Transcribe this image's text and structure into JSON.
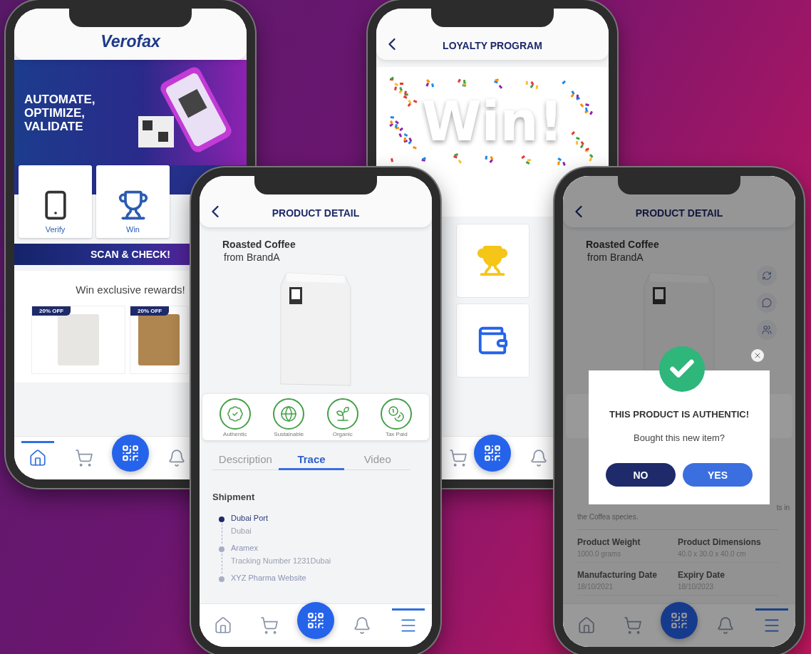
{
  "home_screen": {
    "logo": "Verofax",
    "banner": "AUTOMATE,\nOPTIMIZE,\nVALIDATE",
    "tiles": [
      {
        "label": "Verify"
      },
      {
        "label": "Win"
      }
    ],
    "scan_bar": "SCAN & CHECK!",
    "rewards_title": "Win exclusive rewards!",
    "offers": [
      {
        "badge": "20% OFF"
      },
      {
        "badge": "20% OFF"
      }
    ],
    "nav": [
      {
        "kind": "home",
        "selected": true
      },
      {
        "kind": "cart",
        "selected": false
      },
      {
        "kind": "scan",
        "selected": false
      },
      {
        "kind": "bell",
        "selected": false
      }
    ]
  },
  "loyalty_screen": {
    "title": "LOYALTY PROGRAM",
    "art_text": "Win!",
    "nav": [
      {
        "kind": "cart",
        "selected": false
      },
      {
        "kind": "scan",
        "selected": false
      },
      {
        "kind": "bell",
        "selected": false
      }
    ]
  },
  "product_screen": {
    "title": "PRODUCT DETAIL",
    "product": "Roasted Coffee",
    "brand": "from BrandA",
    "badges": [
      {
        "kind": "stamp",
        "label": "Authentic"
      },
      {
        "kind": "globe",
        "label": "Sustainable"
      },
      {
        "kind": "sprout",
        "label": "Organic"
      },
      {
        "kind": "coins",
        "label": "Tax Paid"
      }
    ],
    "tabs": [
      {
        "label": "Description",
        "selected": false
      },
      {
        "label": "Trace",
        "selected": true
      },
      {
        "label": "Video",
        "selected": false
      }
    ],
    "section": "Shipment",
    "timeline": [
      {
        "title": "Dubai Port",
        "subtitle": "Dubai",
        "active": true
      },
      {
        "title": "Aramex",
        "subtitle": "Tracking Number 1231Dubai",
        "active": false
      },
      {
        "title": "XYZ Pharma Website",
        "active": false
      }
    ],
    "nav": [
      {
        "kind": "home",
        "selected": false
      },
      {
        "kind": "cart",
        "selected": false
      },
      {
        "kind": "scan",
        "selected": false
      },
      {
        "kind": "bell",
        "selected": false
      },
      {
        "kind": "menu",
        "selected": true
      }
    ]
  },
  "authentic_screen": {
    "title": "PRODUCT DETAIL",
    "product": "Roasted Coffee",
    "brand": "from BrandA",
    "description_fragments": [
      "ts in",
      "the Coffea species."
    ],
    "specs": [
      {
        "label": "Product Weight",
        "value": "1000.0 grams"
      },
      {
        "label": "Product Dimensions",
        "value": "40.0 x 30.0 x 40.0 cm"
      },
      {
        "label": "Manufacturing Date",
        "value": "18/10/2021"
      },
      {
        "label": "Expiry Date",
        "value": "18/10/2023"
      }
    ],
    "dialog": {
      "title": "THIS PRODUCT IS AUTHENTIC!",
      "question": "Bought this new item?",
      "buttons": [
        "NO",
        "YES"
      ]
    },
    "nav": [
      {
        "kind": "home",
        "selected": false
      },
      {
        "kind": "cart",
        "selected": false
      },
      {
        "kind": "scan",
        "selected": false
      },
      {
        "kind": "bell",
        "selected": false
      },
      {
        "kind": "menu",
        "selected": true
      }
    ]
  }
}
